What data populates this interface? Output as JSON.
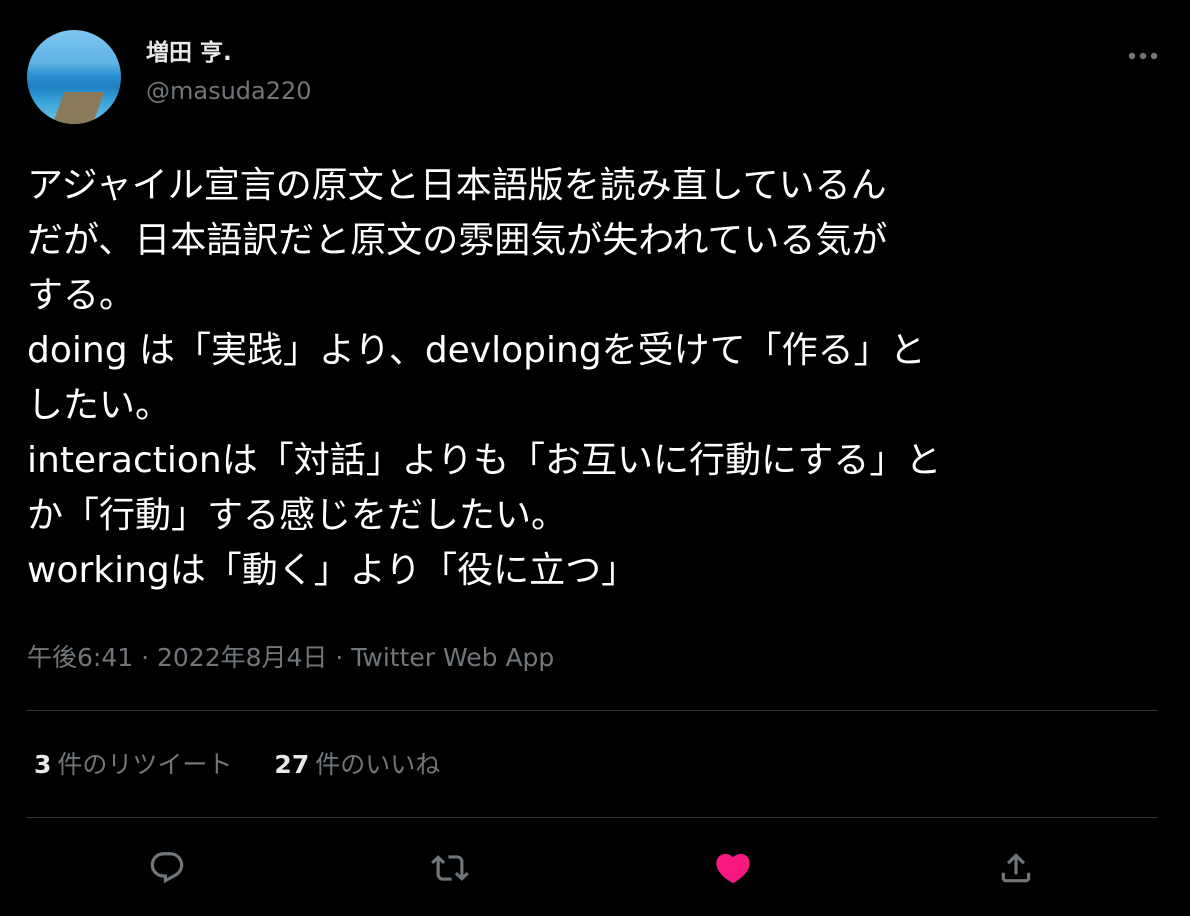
{
  "author": {
    "display_name": "増田 亨.",
    "handle": "@masuda220",
    "avatar_icon": "profile-avatar-photo"
  },
  "tweet": {
    "lines": [
      "アジャイル宣言の原文と日本語版を読み直しているん",
      "だが、日本語訳だと原文の雰囲気が失われている気が",
      "する。",
      "doing は「実践」より、devlopingを受けて「作る」と",
      "したい。",
      "interactionは「対話」よりも「お互いに行動にする」と",
      "か「行動」する感じをだしたい。",
      "workingは「動く」より「役に立つ」"
    ]
  },
  "meta": {
    "time": "午後6:41",
    "separator": " · ",
    "date": "2022年8月4日",
    "source": "Twitter Web App"
  },
  "stats": {
    "retweets_count": "3",
    "retweets_label": "件のリツイート",
    "likes_count": "27",
    "likes_label": "件のいいね"
  },
  "actions": {
    "reply_icon": "reply-icon",
    "retweet_icon": "retweet-icon",
    "like_icon": "heart-icon",
    "share_icon": "share-icon"
  },
  "colors": {
    "background": "#000000",
    "text": "#ffffff",
    "secondary": "#71767b",
    "like": "#f91880",
    "divider": "#2f3336"
  }
}
